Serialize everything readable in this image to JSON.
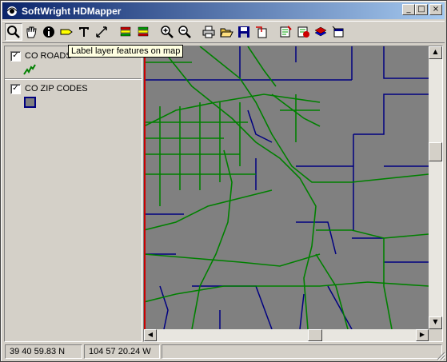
{
  "window": {
    "title": "SoftWright HDMapper"
  },
  "title_buttons": {
    "minimize": "_",
    "maximize": "□",
    "close": "×"
  },
  "toolbar": {
    "buttons": [
      {
        "name": "zoom-select-icon"
      },
      {
        "name": "pan-hand-icon"
      },
      {
        "name": "info-icon"
      },
      {
        "name": "label-layer-icon"
      },
      {
        "name": "text-icon"
      },
      {
        "name": "measure-icon"
      },
      {
        "name": "layers-icon"
      },
      {
        "name": "layers-alt-icon"
      },
      {
        "name": "zoom-in-icon"
      },
      {
        "name": "zoom-out-icon"
      },
      {
        "name": "print-icon"
      },
      {
        "name": "open-folder-icon"
      },
      {
        "name": "save-icon"
      },
      {
        "name": "export-icon"
      },
      {
        "name": "edit-layer-icon"
      },
      {
        "name": "remove-layer-icon"
      },
      {
        "name": "add-layer-icon"
      },
      {
        "name": "properties-icon"
      }
    ],
    "tooltip": "Label layer features on map"
  },
  "legend": {
    "layers": [
      {
        "name": "CO ROADS",
        "checked": "✓",
        "symbol": "line-symbol",
        "color": "#008000"
      },
      {
        "name": "CO ZIP CODES",
        "checked": "✓",
        "symbol": "polygon-symbol",
        "color": "#000080"
      }
    ]
  },
  "map": {
    "background": "#808080",
    "road_color": "#008000",
    "zip_color": "#000080",
    "edge_color": "#cc0000"
  },
  "scrollbars": {
    "up": "▲",
    "down": "▼",
    "left": "◀",
    "right": "▶"
  },
  "status": {
    "latitude": "39 40 59.83 N",
    "longitude": "104 57 20.24 W"
  }
}
